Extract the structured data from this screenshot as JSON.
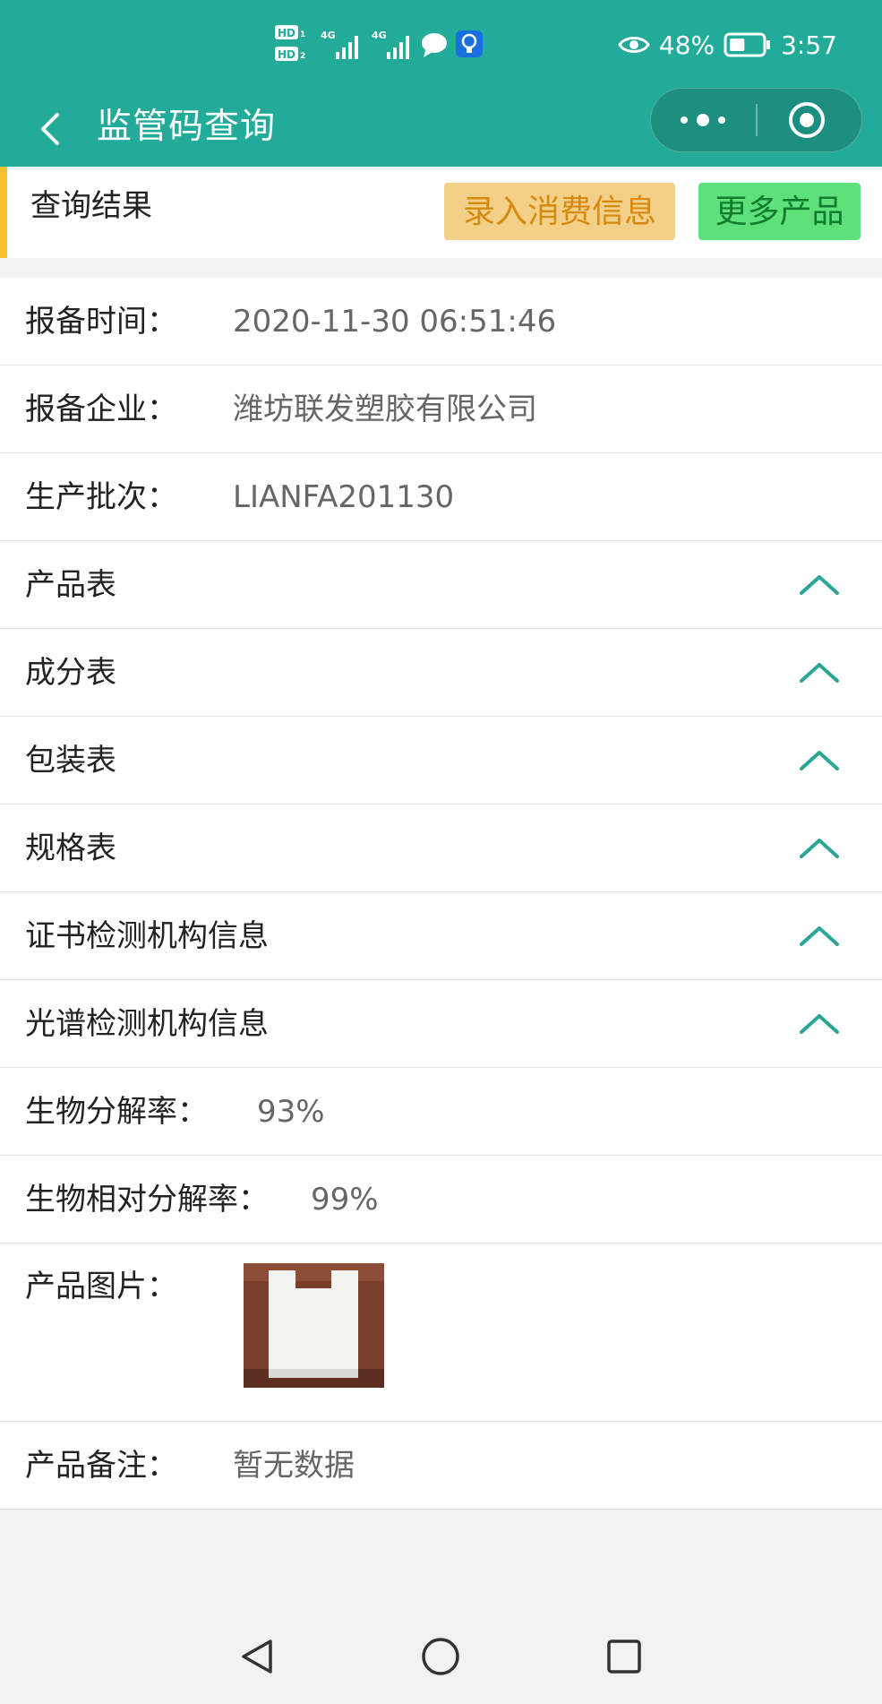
{
  "status_bar": {
    "battery_percent": "48%",
    "battery_level": 0.48,
    "time": "3:57",
    "sim_icons": [
      "hd-1-icon",
      "hd-2-icon",
      "4g-signal-icon",
      "4g-signal-icon",
      "chat-bubble-icon",
      "bulb-app-icon"
    ]
  },
  "navbar": {
    "title": "监管码查询",
    "back_icon": "chevron-left-icon",
    "more_icon": "more-dots-icon",
    "close_icon": "target-circle-icon",
    "bg_color": "#22ab98"
  },
  "result_header": {
    "title": "查询结果",
    "record_button": "录入消费信息",
    "more_products_button": "更多产品",
    "accent_color": "#f1c232"
  },
  "info_rows": [
    {
      "label": "报备时间：",
      "value": "2020-11-30 06:51:46"
    },
    {
      "label": "报备企业：",
      "value": "潍坊联发塑胶有限公司"
    },
    {
      "label": "生产批次：",
      "value": "LIANFA201130"
    }
  ],
  "accordion_rows": [
    {
      "label": "产品表"
    },
    {
      "label": "成分表"
    },
    {
      "label": "包装表"
    },
    {
      "label": "规格表"
    },
    {
      "label": "证书检测机构信息"
    },
    {
      "label": "光谱检测机构信息"
    }
  ],
  "rates": [
    {
      "label": "生物分解率：",
      "value": "93%"
    },
    {
      "label": "生物相对分解率：",
      "value": "99%"
    }
  ],
  "product_image": {
    "label": "产品图片："
  },
  "product_note": {
    "label": "产品备注：",
    "value": "暂无数据"
  },
  "system_nav": [
    "back-triangle-icon",
    "home-circle-icon",
    "recents-square-icon"
  ]
}
